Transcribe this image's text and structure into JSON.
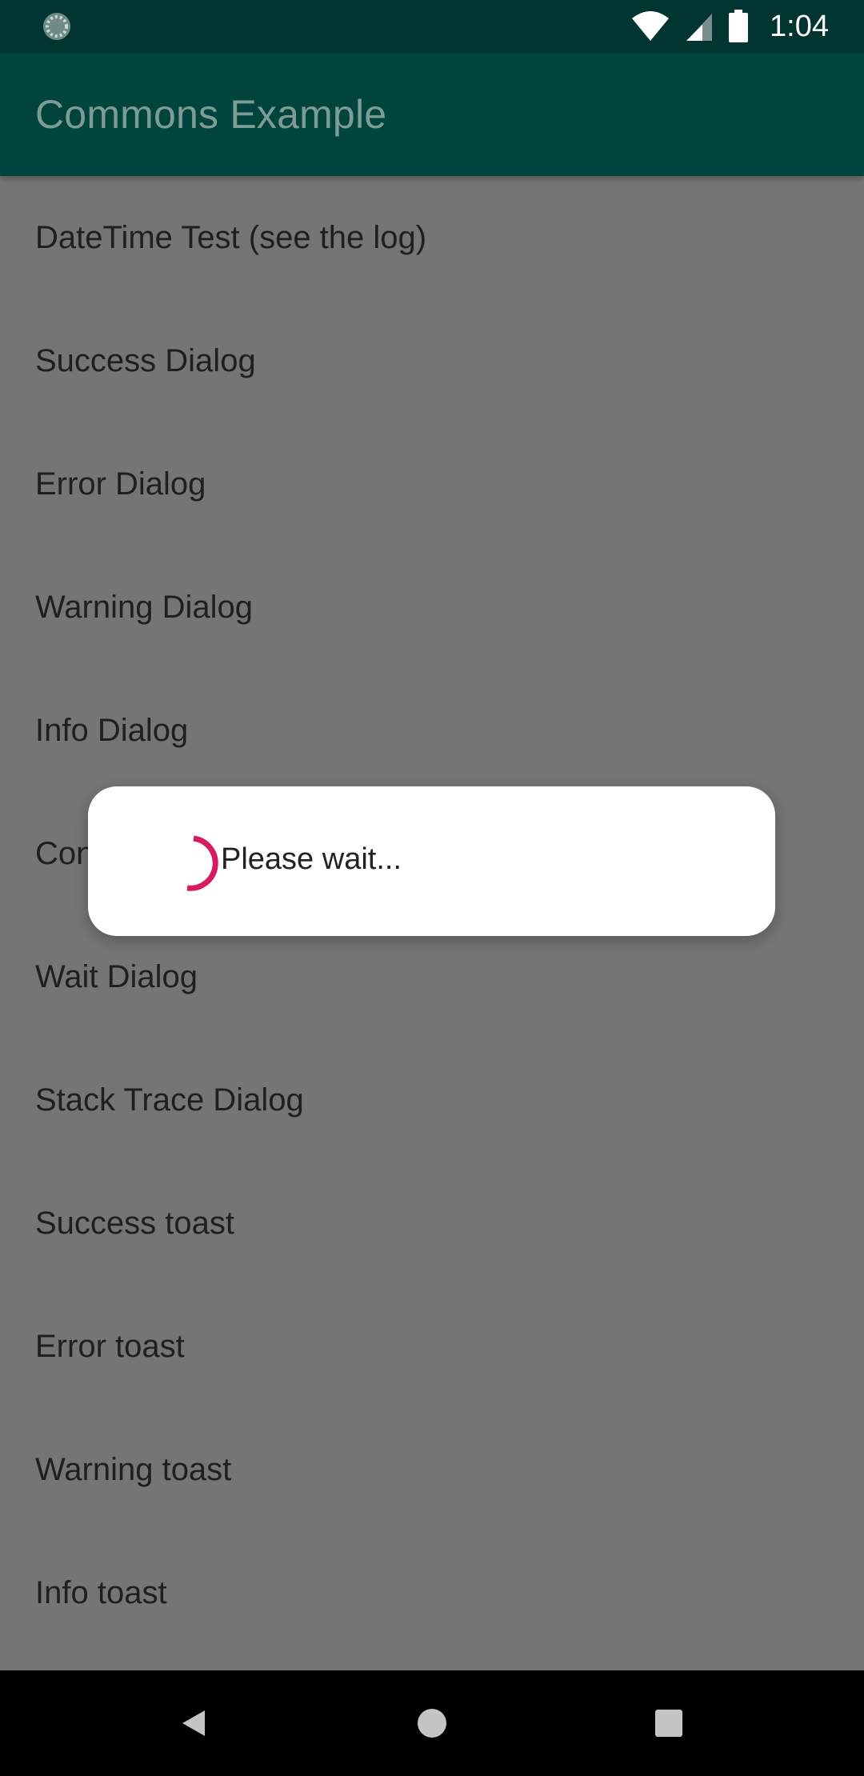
{
  "status_bar": {
    "time": "1:04",
    "icons": [
      "loading-icon",
      "wifi-icon",
      "signal-icon",
      "battery-icon"
    ]
  },
  "app_bar": {
    "title": "Commons Example"
  },
  "list": {
    "items": [
      {
        "label": "DateTime Test (see the log)"
      },
      {
        "label": "Success Dialog"
      },
      {
        "label": "Error Dialog"
      },
      {
        "label": "Warning Dialog"
      },
      {
        "label": "Info Dialog"
      },
      {
        "label": "Con"
      },
      {
        "label": "Wait Dialog"
      },
      {
        "label": "Stack Trace Dialog"
      },
      {
        "label": "Success toast"
      },
      {
        "label": "Error toast"
      },
      {
        "label": "Warning toast"
      },
      {
        "label": "Info toast"
      }
    ]
  },
  "dialog": {
    "message": "Please wait...",
    "spinner_color": "#d81b60"
  },
  "nav_bar": {
    "buttons": [
      "back-icon",
      "home-icon",
      "recents-icon"
    ]
  },
  "colors": {
    "status_bar": "#003531",
    "app_bar": "#00453d",
    "title_text": "#7f9b98",
    "background_dimmed": "#757575",
    "accent": "#d81b60"
  }
}
